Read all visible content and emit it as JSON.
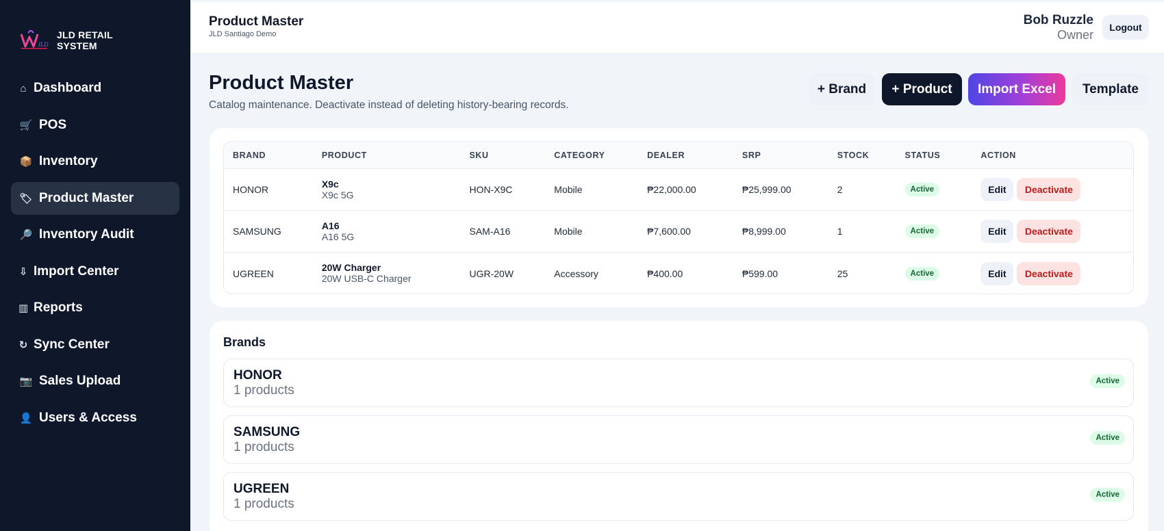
{
  "app": {
    "name": "JLD RETAIL SYSTEM"
  },
  "sidebar": {
    "items": [
      {
        "label": "Dashboard",
        "icon": "⌂",
        "icon_name": "home-icon"
      },
      {
        "label": "POS",
        "icon": "🛒",
        "icon_name": "cart-icon"
      },
      {
        "label": "Inventory",
        "icon": "📦",
        "icon_name": "box-icon"
      },
      {
        "label": "Product Master",
        "icon": "🏷",
        "icon_name": "tag-icon",
        "active": true
      },
      {
        "label": "Inventory Audit",
        "icon": "🔎",
        "icon_name": "magnifier-icon"
      },
      {
        "label": "Import Center",
        "icon": "⇩",
        "icon_name": "download-icon"
      },
      {
        "label": "Reports",
        "icon": "▥",
        "icon_name": "bar-chart-icon"
      },
      {
        "label": "Sync Center",
        "icon": "↻",
        "icon_name": "refresh-icon"
      },
      {
        "label": "Sales Upload",
        "icon": "📷",
        "icon_name": "camera-icon"
      },
      {
        "label": "Users & Access",
        "icon": "👤",
        "icon_name": "user-icon"
      }
    ]
  },
  "topbar": {
    "title": "Product Master",
    "subtitle": "JLD Santiago Demo",
    "user_name": "Bob Ruzzle",
    "user_role": "Owner",
    "logout_label": "Logout"
  },
  "page": {
    "title": "Product Master",
    "description": "Catalog maintenance. Deactivate instead of deleting history-bearing records.",
    "buttons": {
      "brand": "+ Brand",
      "product": "+ Product",
      "import": "Import Excel",
      "template": "Template"
    }
  },
  "products": {
    "columns": [
      "BRAND",
      "PRODUCT",
      "SKU",
      "CATEGORY",
      "DEALER",
      "SRP",
      "STOCK",
      "STATUS",
      "ACTION"
    ],
    "rows": [
      {
        "brand": "HONOR",
        "name": "X9c",
        "variant": "X9c 5G",
        "sku": "HON-X9C",
        "category": "Mobile",
        "dealer": "₱22,000.00",
        "srp": "₱25,999.00",
        "stock": "2",
        "status": "Active"
      },
      {
        "brand": "SAMSUNG",
        "name": "A16",
        "variant": "A16 5G",
        "sku": "SAM-A16",
        "category": "Mobile",
        "dealer": "₱7,600.00",
        "srp": "₱8,999.00",
        "stock": "1",
        "status": "Active"
      },
      {
        "brand": "UGREEN",
        "name": "20W Charger",
        "variant": "20W USB-C Charger",
        "sku": "UGR-20W",
        "category": "Accessory",
        "dealer": "₱400.00",
        "srp": "₱599.00",
        "stock": "25",
        "status": "Active"
      }
    ],
    "edit_label": "Edit",
    "deactivate_label": "Deactivate"
  },
  "brands": {
    "title": "Brands",
    "items": [
      {
        "name": "HONOR",
        "count": "1 products",
        "status": "Active"
      },
      {
        "name": "SAMSUNG",
        "count": "1 products",
        "status": "Active"
      },
      {
        "name": "UGREEN",
        "count": "1 products",
        "status": "Active"
      }
    ]
  },
  "colors": {
    "sidebar_bg": "#0f172a",
    "active_bg": "#273245",
    "primary_dark": "#0f172a",
    "gradient_start": "#4f46e5",
    "gradient_end": "#ec3a9b",
    "success_bg": "#dcfce7",
    "success_text": "#166534",
    "danger_bg": "#fde2e2",
    "danger_text": "#b91c1c"
  }
}
